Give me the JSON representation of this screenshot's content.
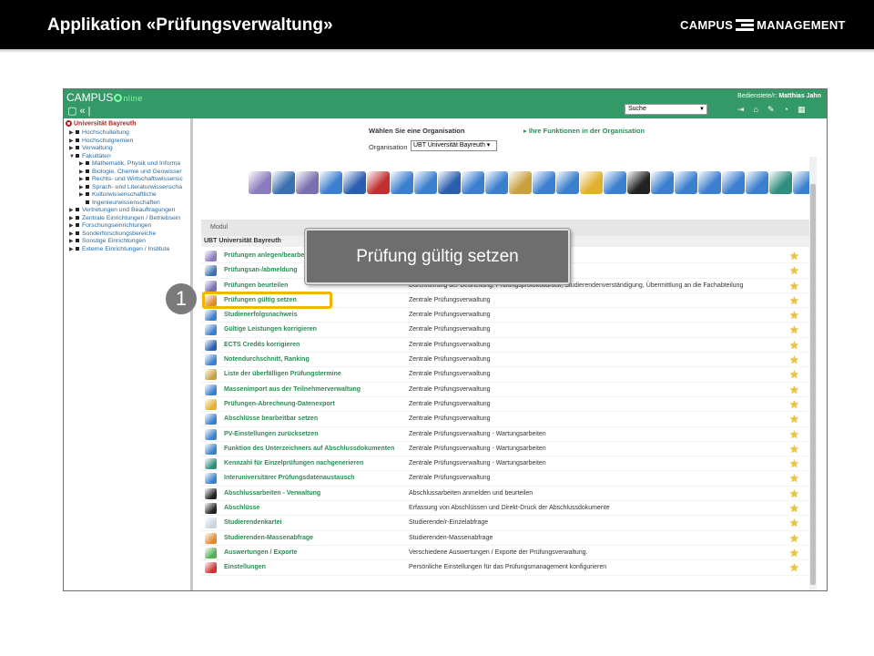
{
  "slide": {
    "title": "Applikation «Prüfungsverwaltung»",
    "brand_left": "CAMPUS",
    "brand_right": "MANAGEMENT"
  },
  "app": {
    "logo_text": "CAMPUS",
    "logo_suffix": "nline",
    "user_label": "Bedienstete/r:",
    "user_name": "Matthias Jahn",
    "search_value": "Suche"
  },
  "sidebar": {
    "university": "Universität Bayreuth",
    "items": [
      {
        "label": "Hochschulleitung",
        "level": 0,
        "arrow": "▶"
      },
      {
        "label": "Hochschulgremien",
        "level": 0,
        "arrow": "▶"
      },
      {
        "label": "Verwaltung",
        "level": 0,
        "arrow": "▶"
      },
      {
        "label": "Fakultäten",
        "level": 0,
        "arrow": "▼"
      },
      {
        "label": "Mathematik, Physik und Informa",
        "level": 1,
        "arrow": "▶"
      },
      {
        "label": "Biologie, Chemie und Geowisser",
        "level": 1,
        "arrow": "▶"
      },
      {
        "label": "Rechts- und Wirtschaftswissensc",
        "level": 1,
        "arrow": "▶"
      },
      {
        "label": "Sprach- und Literaturwissenscha",
        "level": 1,
        "arrow": "▶"
      },
      {
        "label": "Kulturwissenschaftliche",
        "level": 1,
        "arrow": "▶"
      },
      {
        "label": "Ingenieurwissenschaften",
        "level": 1,
        "arrow": ""
      },
      {
        "label": "Vertretungen und Beauftragungen",
        "level": 0,
        "arrow": "▶"
      },
      {
        "label": "Zentrale Einrichtungen / Betriebsein",
        "level": 0,
        "arrow": "▶"
      },
      {
        "label": "Forschungseinrichtungen",
        "level": 0,
        "arrow": "▶"
      },
      {
        "label": "Sonderforschungsbereiche",
        "level": 0,
        "arrow": "▶"
      },
      {
        "label": "Sonstige Einrichtungen",
        "level": 0,
        "arrow": "▶"
      },
      {
        "label": "Externe Einrichtungen / Institute",
        "level": 0,
        "arrow": "▶"
      }
    ]
  },
  "org": {
    "question": "Wählen Sie eine Organisation",
    "functions_link": "▸ Ihre Funktionen in der Organisation",
    "label": "Organisation",
    "selected": "UBT Universität Bayreuth"
  },
  "table": {
    "column_header": "Modul",
    "org_header": "UBT Universität Bayreuth",
    "rows": [
      {
        "name": "Prüfungen anlegen/bearbeiten",
        "desc": "",
        "icon_color": "#8a7bbf"
      },
      {
        "name": "Prüfungsan-/abmeldung",
        "desc": "",
        "icon_color": "#3a6fb0"
      },
      {
        "name": "Prüfungen beurteilen",
        "desc": "Durchführung der Beurteilung, Prüfungsprotokolldruck, Studierendenverständigung, Übermittlung an die Fachabteilung",
        "icon_color": "#7c6fb0"
      },
      {
        "name": "Prüfungen gültig setzen",
        "desc": "Zentrale Prüfungsverwaltung",
        "icon_color": "#e08a2c"
      },
      {
        "name": "Studienerfolgsnachweis",
        "desc": "Zentrale Prüfungsverwaltung",
        "icon_color": "#3b7fcf"
      },
      {
        "name": "Gültige Leistungen korrigieren",
        "desc": "Zentrale Prüfungsverwaltung",
        "icon_color": "#3b7fcf"
      },
      {
        "name": "ECTS Credits korrigieren",
        "desc": "Zentrale Prüfungsverwaltung",
        "icon_color": "#2a5fb0"
      },
      {
        "name": "Notendurchschnitt, Ranking",
        "desc": "Zentrale Prüfungsverwaltung",
        "icon_color": "#3b7fcf"
      },
      {
        "name": "Liste der überfälligen Prüfungstermine",
        "desc": "Zentrale Prüfungsverwaltung",
        "icon_color": "#c9a040"
      },
      {
        "name": "Massenimport aus der Teilnehmerverwaltung",
        "desc": "Zentrale Prüfungsverwaltung",
        "icon_color": "#3b7fcf"
      },
      {
        "name": "Prüfungen-Abrechnung-Datenexport",
        "desc": "Zentrale Prüfungsverwaltung",
        "icon_color": "#e0b030"
      },
      {
        "name": "Abschlüsse bearbeitbar setzen",
        "desc": "Zentrale Prüfungsverwaltung",
        "icon_color": "#3b7fcf"
      },
      {
        "name": "PV-Einstellungen zurücksetzen",
        "desc": "Zentrale Prüfungsverwaltung - Wartungsarbeiten",
        "icon_color": "#3b7fcf"
      },
      {
        "name": "Funktion des Unterzeichners auf Abschlussdokumenten",
        "desc": "Zentrale Prüfungsverwaltung - Wartungsarbeiten",
        "icon_color": "#3b7fcf"
      },
      {
        "name": "Kennzahl für Einzelprüfungen nachgenerieren",
        "desc": "Zentrale Prüfungsverwaltung - Wartungsarbeiten",
        "icon_color": "#2f8f7f"
      },
      {
        "name": "Interuniversitärer Prüfungsdatenaustausch",
        "desc": "Zentrale Prüfungsverwaltung",
        "icon_color": "#3b7fcf"
      },
      {
        "name": "Abschlussarbeiten - Verwaltung",
        "desc": "Abschlussarbeiten anmelden und beurteilen",
        "icon_color": "#222222"
      },
      {
        "name": "Abschlüsse",
        "desc": "Erfassung von Abschlüssen und Direkt-Druck der Abschlussdokumente",
        "icon_color": "#222222"
      },
      {
        "name": "Studierendenkartei",
        "desc": "Studierende/r-Einzelabfrage",
        "icon_color": "#c8d4e0"
      },
      {
        "name": "Studierenden-Massenabfrage",
        "desc": "Studierenden-Massenabfrage",
        "icon_color": "#e08a2c"
      },
      {
        "name": "Auswertungen / Exporte",
        "desc": "Verschiedene Auswertungen / Exporte der Prüfungsverwaltung.",
        "icon_color": "#4caf50"
      },
      {
        "name": "Einstellungen",
        "desc": "Persönliche Einstellungen für das Prüfungsmanagement konfigurieren",
        "icon_color": "#d03030"
      }
    ]
  },
  "overlay": {
    "callout_text": "Prüfung gültig setzen",
    "step_number": "1"
  },
  "strip_colors": [
    "#8a7bbf",
    "#3a6fb0",
    "#7c6fb0",
    "#3b7fcf",
    "#2a5fb0",
    "#c03030",
    "#3b7fcf",
    "#3b7fcf",
    "#2a5fb0",
    "#3b7fcf",
    "#3b7fcf",
    "#c9a040",
    "#3b7fcf",
    "#3b7fcf",
    "#e0b030",
    "#3b7fcf",
    "#222222",
    "#3b7fcf",
    "#3b7fcf",
    "#3b7fcf",
    "#3b7fcf",
    "#3b7fcf",
    "#2f8f7f",
    "#3b7fcf",
    "#222222",
    "#222222",
    "#c8d4e0",
    "#e08a2c",
    "#4caf50",
    "#d03030"
  ]
}
